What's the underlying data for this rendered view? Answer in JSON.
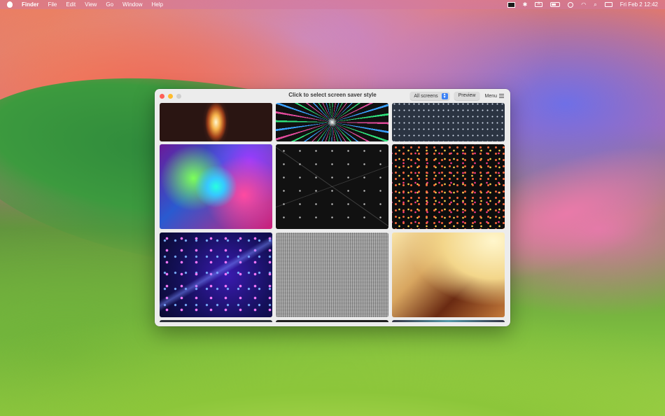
{
  "menubar": {
    "app_name": "Finder",
    "items": [
      "File",
      "Edit",
      "View",
      "Go",
      "Window",
      "Help"
    ],
    "input_source": "A",
    "clock": "Fri Feb 2  12:42"
  },
  "window": {
    "title": "Click to select screen saver style",
    "screens_select": "All screens",
    "preview_label": "Preview",
    "menu_label": "Menu"
  },
  "tiles": [
    {
      "name": "flame-saver-tile"
    },
    {
      "name": "starburst-saver-tile"
    },
    {
      "name": "dots-saver-tile"
    },
    {
      "name": "spiral-lights-saver-tile"
    },
    {
      "name": "network-lines-saver-tile"
    },
    {
      "name": "confetti-particles-saver-tile"
    },
    {
      "name": "bokeh-space-saver-tile"
    },
    {
      "name": "static-noise-saver-tile"
    },
    {
      "name": "cube-tunnel-saver-tile"
    }
  ]
}
